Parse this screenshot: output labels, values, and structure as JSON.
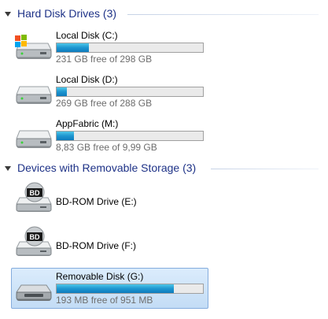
{
  "groups": [
    {
      "title": "Hard Disk Drives (3)"
    },
    {
      "title": "Devices with Removable Storage (3)"
    }
  ],
  "drives": [
    {
      "name": "Local Disk (C:)",
      "free_text": "231 GB free of 298 GB",
      "used_fraction": 0.22,
      "icon": "windows-drive-icon"
    },
    {
      "name": "Local Disk (D:)",
      "free_text": "269 GB free of 288 GB",
      "used_fraction": 0.07,
      "icon": "hard-drive-icon"
    },
    {
      "name": "AppFabric (M:)",
      "free_text": "8,83 GB free of 9,99 GB",
      "used_fraction": 0.12,
      "icon": "hard-drive-icon"
    }
  ],
  "removable": [
    {
      "name": "BD-ROM Drive (E:)",
      "icon": "bd-rom-drive-icon",
      "badge": "BD"
    },
    {
      "name": "BD-ROM Drive (F:)",
      "icon": "bd-rom-drive-icon",
      "badge": "BD"
    },
    {
      "name": "Removable Disk (G:)",
      "free_text": "193 MB free of 951 MB",
      "used_fraction": 0.8,
      "icon": "removable-drive-icon",
      "selected": true
    }
  ],
  "colors": {
    "header_text": "#1e3287",
    "bar_fill": "#1e96d0",
    "selection_border": "#84acdd"
  }
}
